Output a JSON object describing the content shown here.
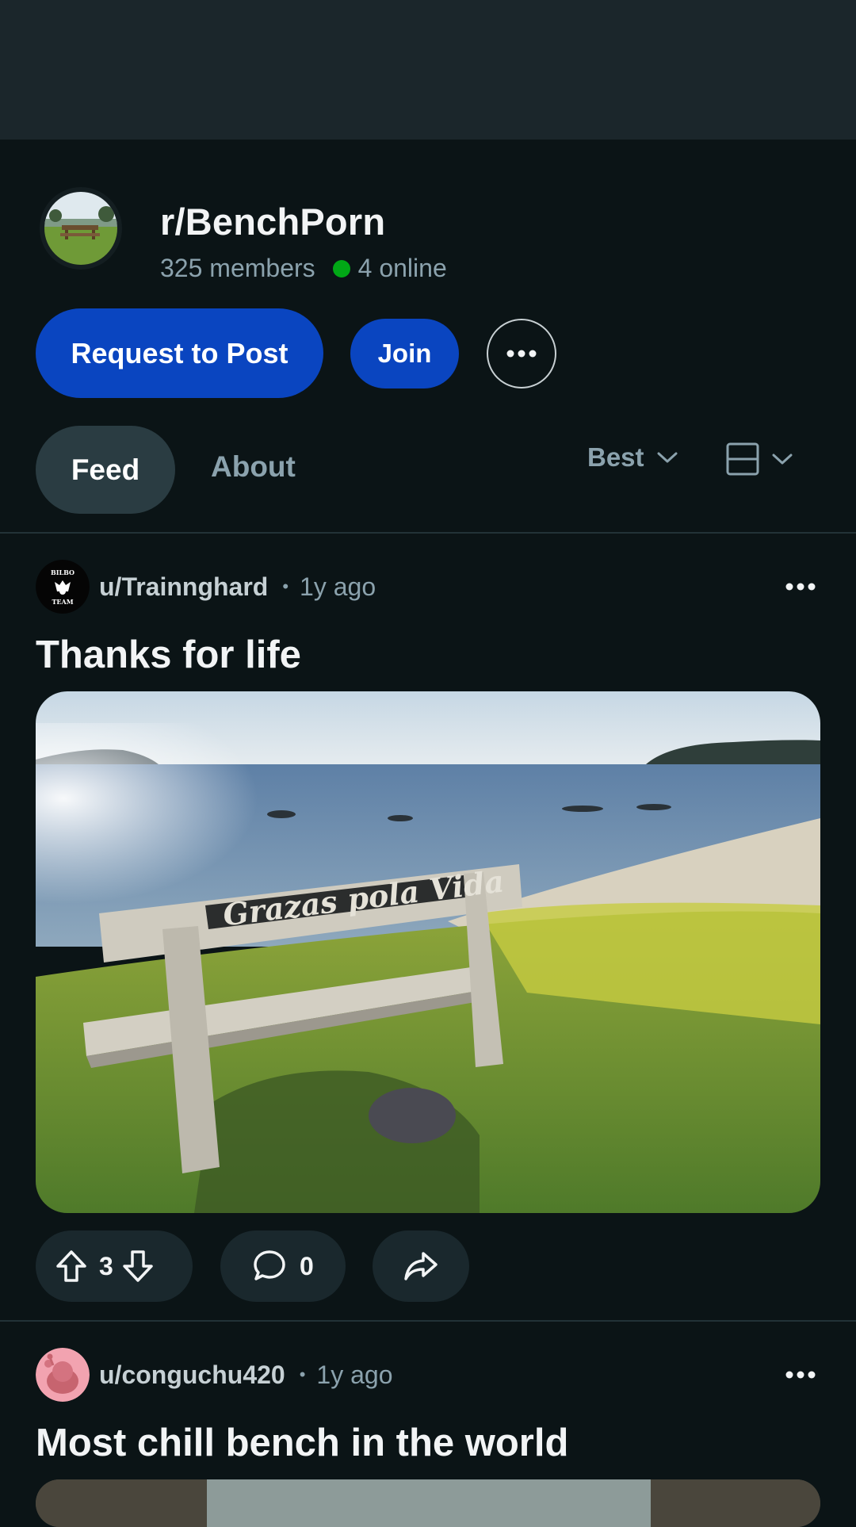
{
  "subreddit": {
    "name": "r/BenchPorn",
    "members": "325 members",
    "online": "4 online"
  },
  "actions": {
    "request_label": "Request to Post",
    "join_label": "Join"
  },
  "tabs": [
    {
      "label": "Feed",
      "active": true
    },
    {
      "label": "About",
      "active": false
    }
  ],
  "sort": {
    "label": "Best"
  },
  "posts": [
    {
      "user": "u/Trainnghard",
      "time": "1y ago",
      "title": "Thanks for life",
      "image_text": "Grazas pola Vida",
      "votes": "3",
      "comments": "0"
    },
    {
      "user": "u/conguchu420",
      "time": "1y ago",
      "title": "Most chill bench in the world"
    }
  ],
  "colors": {
    "background": "#0b1416",
    "topbar": "#1b262b",
    "primary_button": "#0a45c0",
    "online_dot": "#01a816",
    "muted_text": "#8ba2ad"
  },
  "icons": [
    "more-icon",
    "chevron-down-icon",
    "layout-icon",
    "upvote-icon",
    "downvote-icon",
    "comment-icon",
    "share-icon"
  ]
}
